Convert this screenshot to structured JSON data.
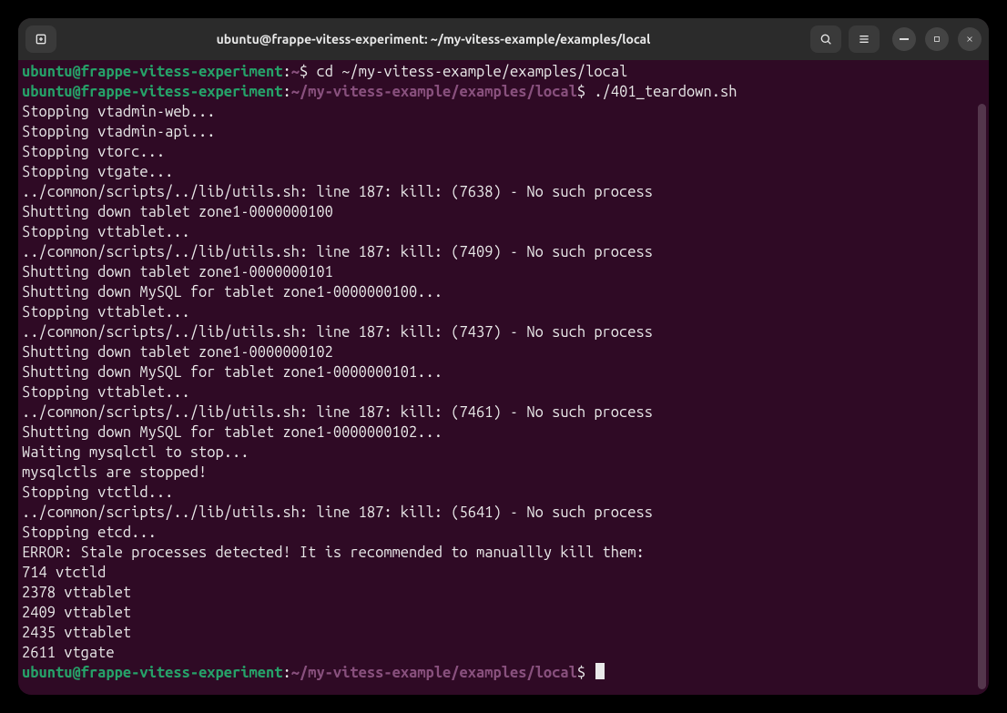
{
  "window": {
    "title": "ubuntu@frappe-vitess-experiment: ~/my-vitess-example/examples/local"
  },
  "prompt": {
    "user": "ubuntu",
    "at": "@",
    "host": "frappe-vitess-experiment",
    "home_path": "~",
    "cwd_path": "~/my-vitess-example/examples/local",
    "sep": ":",
    "dollar": "$"
  },
  "commands": {
    "cd": "cd ~/my-vitess-example/examples/local",
    "teardown": "./401_teardown.sh"
  },
  "output_lines": [
    "Stopping vtadmin-web...",
    "Stopping vtadmin-api...",
    "Stopping vtorc...",
    "Stopping vtgate...",
    "../common/scripts/../lib/utils.sh: line 187: kill: (7638) - No such process",
    "Shutting down tablet zone1-0000000100",
    "Stopping vttablet...",
    "../common/scripts/../lib/utils.sh: line 187: kill: (7409) - No such process",
    "Shutting down tablet zone1-0000000101",
    "Shutting down MySQL for tablet zone1-0000000100...",
    "Stopping vttablet...",
    "../common/scripts/../lib/utils.sh: line 187: kill: (7437) - No such process",
    "Shutting down tablet zone1-0000000102",
    "Shutting down MySQL for tablet zone1-0000000101...",
    "Stopping vttablet...",
    "../common/scripts/../lib/utils.sh: line 187: kill: (7461) - No such process",
    "Shutting down MySQL for tablet zone1-0000000102...",
    "Waiting mysqlctl to stop...",
    "mysqlctls are stopped!",
    "Stopping vtctld...",
    "../common/scripts/../lib/utils.sh: line 187: kill: (5641) - No such process",
    "Stopping etcd...",
    "ERROR: Stale processes detected! It is recommended to manuallly kill them:",
    "714 vtctld",
    "2378 vttablet",
    "2409 vttablet",
    "2435 vttablet",
    "2611 vtgate"
  ]
}
